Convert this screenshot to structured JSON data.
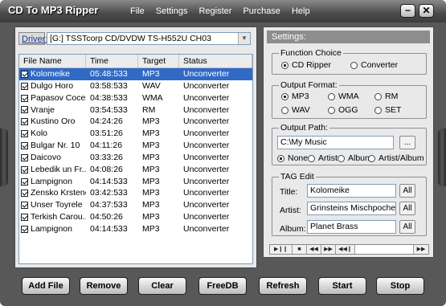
{
  "app": {
    "title": "CD To MP3 Ripper",
    "menu": [
      "File",
      "Settings",
      "Register",
      "Purchase",
      "Help"
    ],
    "min_glyph": "−",
    "close_glyph": "✕"
  },
  "drive": {
    "label": "Driver:",
    "value": "[G:]  TSSTcorp  CD/DVDW TS-H552U  CH03"
  },
  "track_list": {
    "columns": [
      "File  Name",
      "Time",
      "Target",
      "Status"
    ],
    "rows": [
      {
        "name": "Kolomeike",
        "time": "05:48:533",
        "target": "MP3",
        "status": "Unconverter"
      },
      {
        "name": "Dulgo Horo",
        "time": "03:58:533",
        "target": "WAV",
        "status": "Unconverter"
      },
      {
        "name": "Papasov Cocek",
        "time": "04:38:533",
        "target": "WMA",
        "status": "Unconverter"
      },
      {
        "name": "Vranje",
        "time": "03:54:533",
        "target": "RM",
        "status": "Unconverter"
      },
      {
        "name": "Kustino Oro",
        "time": "04:24:26",
        "target": "MP3",
        "status": "Unconverter"
      },
      {
        "name": "Kolo",
        "time": "03:51:26",
        "target": "MP3",
        "status": "Unconverter"
      },
      {
        "name": "Bulgar Nr. 10",
        "time": "04:11:26",
        "target": "MP3",
        "status": "Unconverter"
      },
      {
        "name": "Daicovo",
        "time": "03:33:26",
        "target": "MP3",
        "status": "Unconverter"
      },
      {
        "name": "Lebedik un Fr...",
        "time": "04:08:26",
        "target": "MP3",
        "status": "Unconverter"
      },
      {
        "name": "Lampignon",
        "time": "04:14:533",
        "target": "MP3",
        "status": "Unconverter"
      },
      {
        "name": "Zensko Krsteno",
        "time": "03:42:533",
        "target": "MP3",
        "status": "Unconverter"
      },
      {
        "name": "Unser Toyrele",
        "time": "04:37:533",
        "target": "MP3",
        "status": "Unconverter"
      },
      {
        "name": "Terkish Carou...",
        "time": "04:50:26",
        "target": "MP3",
        "status": "Unconverter"
      },
      {
        "name": "Lampignon",
        "time": "04:14:533",
        "target": "MP3",
        "status": "Unconverter"
      }
    ]
  },
  "settings": {
    "header": "Settings:",
    "function_choice": {
      "legend": "Function Choice",
      "options": [
        "CD Ripper",
        "Converter"
      ],
      "selected": "CD Ripper"
    },
    "output_format": {
      "legend": "Output Format:",
      "options": [
        "MP3",
        "WMA",
        "RM",
        "WAV",
        "OGG",
        "SET"
      ],
      "selected": "MP3"
    },
    "output_path": {
      "legend": "Output Path:",
      "value": "C:\\My Music",
      "browse_label": "...",
      "naming_options": [
        "None",
        "Artist",
        "Album",
        "Artist/Album"
      ],
      "naming_selected": "None"
    },
    "tag_edit": {
      "legend": "TAG Edit",
      "title_label": "Title:",
      "title_value": "Kolomeike",
      "artist_label": "Artist:",
      "artist_value": "Grinsteins Mischpoche",
      "album_label": "Album:",
      "album_value": "Planet Brass",
      "all_label": "All"
    }
  },
  "transport": [
    "▶❙❙",
    "■",
    "◀◀",
    "▶▶",
    "◀◀❙",
    "",
    "▶▶"
  ],
  "buttons": [
    "Add File",
    "Remove",
    "Clear",
    "FreeDB",
    "Refresh",
    "Start",
    "Stop"
  ]
}
